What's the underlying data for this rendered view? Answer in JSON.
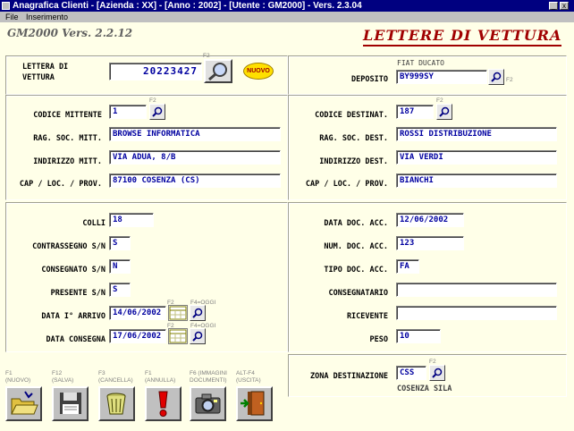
{
  "window": {
    "title": "Anagrafica Clienti  - [Azienda : XX] - [Anno : 2002] - [Utente : GM2000] - Vers. 2.3.04",
    "minimize": "_",
    "close": "x"
  },
  "menu": [
    "File",
    "Inserimento"
  ],
  "app_version": "GM2000 Vers. 2.2.12",
  "page_title": "LETTERE DI VETTURA",
  "lettera": {
    "label": "LETTERA DI VETTURA",
    "value": "20223427",
    "f2": "F2",
    "nuovo": "NUOVO"
  },
  "deposito": {
    "vehicle": "FIAT DUCATO",
    "label": "DEPOSITO",
    "value": "BY999SY",
    "f2": "F2"
  },
  "mittente": {
    "codice_label": "CODICE MITTENTE",
    "codice_value": "1",
    "f2": "F2",
    "rag_label": "RAG. SOC. MITT.",
    "rag_value": "BROWSE INFORMATICA",
    "indirizzo_label": "INDIRIZZO MITT.",
    "indirizzo_value": "VIA ADUA, 8/B",
    "cap_label": "CAP / LOC. / PROV.",
    "cap_value": "87100 COSENZA (CS)"
  },
  "destinatario": {
    "codice_label": "CODICE DESTINAT.",
    "codice_value": "187",
    "f2": "F2",
    "rag_label": "RAG. SOC. DEST.",
    "rag_value": "ROSSI DISTRIBUZIONE",
    "indirizzo_label": "INDIRIZZO DEST.",
    "indirizzo_value": "VIA VERDI",
    "cap_label": "CAP / LOC. / PROV.",
    "cap_value": "BIANCHI"
  },
  "left_fields": {
    "colli_label": "COLLI",
    "colli_value": "18",
    "contrassegno_label": "CONTRASSEGNO S/N",
    "contrassegno_value": "S",
    "consegnato_label": "CONSEGNATO S/N",
    "consegnato_value": "N",
    "presente_label": "PRESENTE S/N",
    "presente_value": "S",
    "arrivo_label": "DATA I° ARRIVO",
    "arrivo_value": "14/06/2002",
    "consegna_label": "DATA CONSEGNA",
    "consegna_value": "17/06/2002",
    "f2": "F2",
    "f4oggi": "F4=OGGI"
  },
  "right_fields": {
    "data_doc_label": "DATA DOC. ACC.",
    "data_doc_value": "12/06/2002",
    "num_doc_label": "NUM. DOC. ACC.",
    "num_doc_value": "123",
    "tipo_doc_label": "TIPO DOC. ACC.",
    "tipo_doc_value": "FA",
    "consegnatario_label": "CONSEGNATARIO",
    "consegnatario_value": "",
    "ricevente_label": "RICEVENTE",
    "ricevente_value": "",
    "peso_label": "PESO",
    "peso_value": "10"
  },
  "zona": {
    "label": "ZONA DESTINAZIONE",
    "value": "CSS",
    "f2": "F2",
    "descr": "COSENZA SILA"
  },
  "toolbar": [
    {
      "key": "F1",
      "action": "(NUOVO)",
      "icon": "folder-open-icon"
    },
    {
      "key": "F12",
      "action": "(SALVA)",
      "icon": "floppy-disk-icon"
    },
    {
      "key": "F3",
      "action": "(CANCELLA)",
      "icon": "trash-bin-icon"
    },
    {
      "key": "F1",
      "action": "(ANNULLA)",
      "icon": "exclamation-icon"
    },
    {
      "key": "F6 (IMMAGINI",
      "action": "DOCUMENTI)",
      "icon": "camera-icon"
    },
    {
      "key": "ALT-F4",
      "action": "(USCITA)",
      "icon": "exit-door-icon"
    }
  ],
  "colors": {
    "background": "#ffffe8",
    "titlebar": "#000080",
    "field_text": "#0000a0",
    "heading_red": "#a00000"
  }
}
